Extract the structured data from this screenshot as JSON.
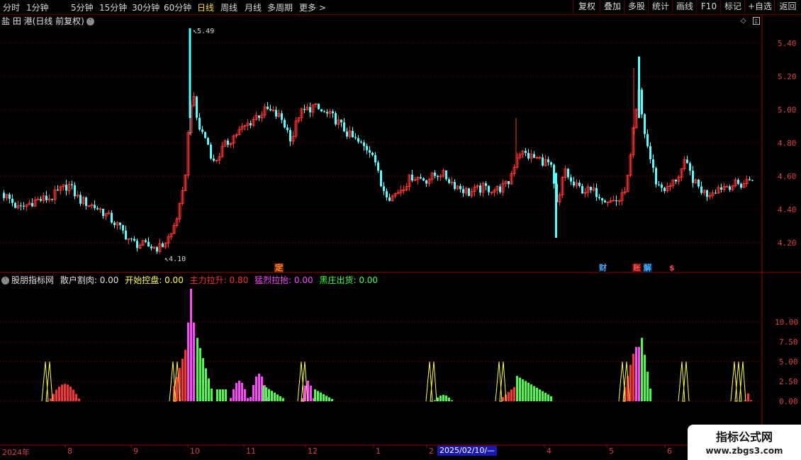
{
  "toolbar": {
    "periods": [
      {
        "label": "分时",
        "active": false
      },
      {
        "label": "1分钟",
        "active": false
      },
      {
        "label": "5分钟",
        "active": false
      },
      {
        "label": "15分钟",
        "active": false
      },
      {
        "label": "30分钟",
        "active": false
      },
      {
        "label": "60分钟",
        "active": false
      },
      {
        "label": "日线",
        "active": true
      },
      {
        "label": "周线",
        "active": false
      },
      {
        "label": "月线",
        "active": false
      },
      {
        "label": "多周期",
        "active": false
      },
      {
        "label": "更多",
        "active": false
      }
    ],
    "more_arrow": ">",
    "right_buttons": [
      "复权",
      "叠加",
      "多股",
      "统计",
      "画线",
      "F10",
      "标记",
      "+自选",
      "返回"
    ]
  },
  "stock": {
    "name": "盐 田 港",
    "mode": "(日线 前复权)",
    "dropdown_glyph": "˅"
  },
  "price_axis": [
    "5.40",
    "5.20",
    "5.00",
    "4.80",
    "4.60",
    "4.40",
    "4.20"
  ],
  "annotations": {
    "high": "5.49",
    "low": "4.10"
  },
  "events": [
    {
      "label": "定",
      "color": "#ff8a2a",
      "bg": "#7a2a00"
    },
    {
      "label": "财",
      "color": "#4aa8ff",
      "bg": "#000000"
    },
    {
      "label": "账",
      "color": "#ff5050",
      "bg": "#5a0000"
    },
    {
      "label": "解",
      "color": "#4aa8ff",
      "bg": "#003050"
    },
    {
      "label": "$",
      "color": "#ff4040",
      "bg": "#000000"
    }
  ],
  "indicator": {
    "name": "股朋指标网",
    "items": [
      {
        "label": "散户割肉: 0.00",
        "color": "#e0e0e0"
      },
      {
        "label": "开始控盘: 0.00",
        "color": "#ffff44"
      },
      {
        "label": "主力拉升: 0.80",
        "color": "#ff3030"
      },
      {
        "label": "猛烈拉抬: 0.00",
        "color": "#ff44ff"
      },
      {
        "label": "黑庄出货: 0.00",
        "color": "#44ff44"
      }
    ],
    "axis": [
      "10.00",
      "7.50",
      "5.00",
      "2.50",
      "0.00"
    ]
  },
  "time_axis": [
    "2024年",
    "8",
    "9",
    "10",
    "11",
    "12",
    "1",
    "2",
    "4",
    "5",
    "6"
  ],
  "cursor_date": "2025/02/10/—",
  "watermark": {
    "title": "指标公式网",
    "url": "www.zbgs3.com"
  },
  "colors": {
    "up": "#ff3232",
    "down": "#54ffff",
    "grid": "#8b0000",
    "frame": "#a00000"
  }
}
